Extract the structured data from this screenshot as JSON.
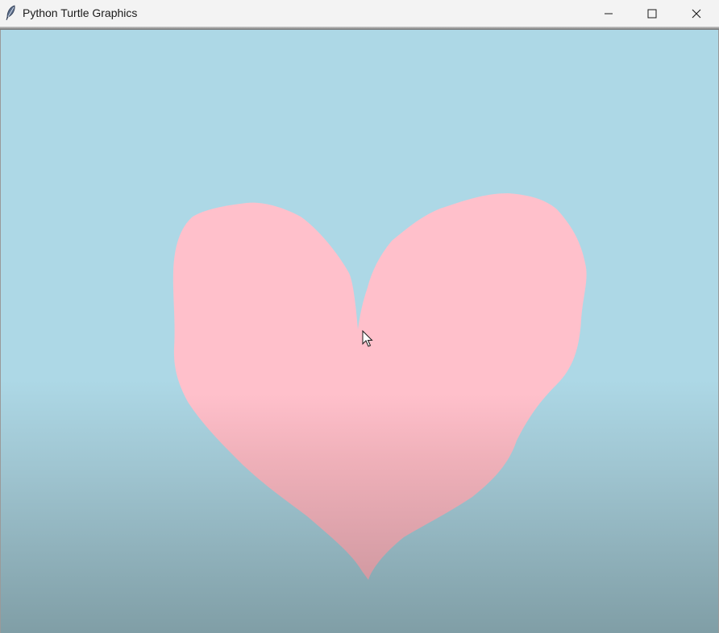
{
  "window": {
    "title": "Python Turtle Graphics",
    "controls": {
      "minimize": "minimize-icon",
      "maximize": "maximize-icon",
      "close": "close-icon"
    }
  },
  "canvas": {
    "background_color": "#add8e6",
    "shape": "heart",
    "shape_fill": "#ffc0cb",
    "cursor": "arrow-pointer-icon"
  }
}
